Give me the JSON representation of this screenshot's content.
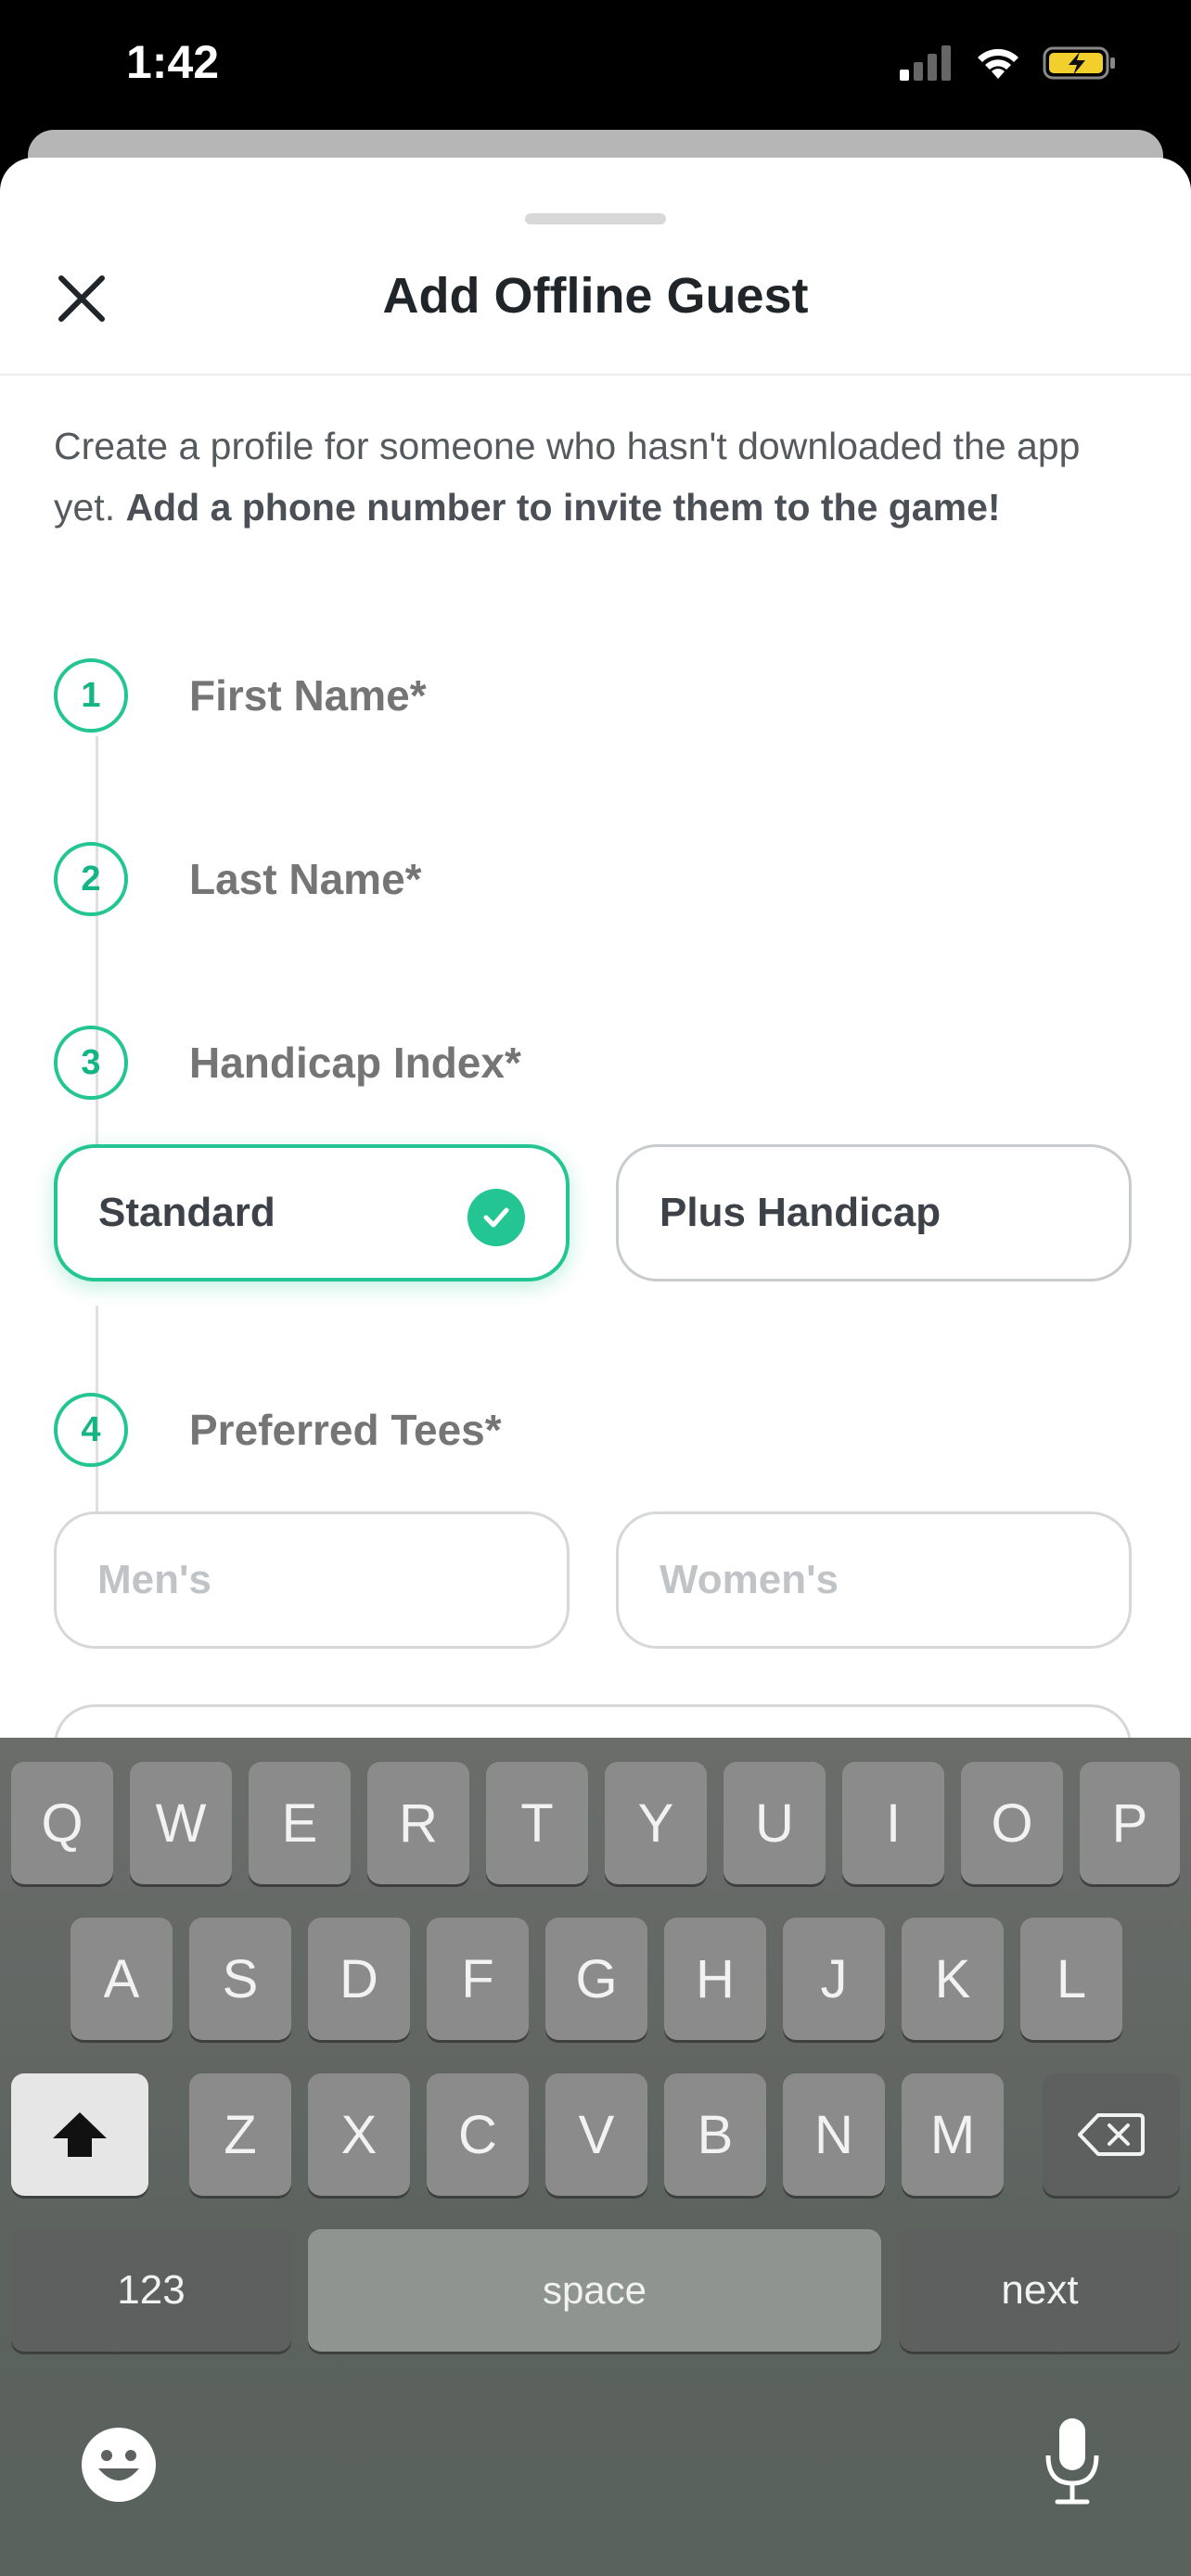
{
  "status_bar": {
    "time": "1:42"
  },
  "sheet": {
    "title": "Add Offline Guest",
    "intro_regular": "Create a profile for someone who hasn't downloaded the app yet. ",
    "intro_bold": "Add a phone number to invite them to the game!",
    "steps": [
      {
        "number": "1",
        "placeholder": "First Name*"
      },
      {
        "number": "2",
        "placeholder": "Last Name*"
      },
      {
        "number": "3",
        "placeholder": "Handicap Index*"
      },
      {
        "number": "4",
        "placeholder": "Preferred Tees*"
      }
    ],
    "handicap_options": [
      {
        "label": "Standard",
        "selected": true
      },
      {
        "label": "Plus Handicap",
        "selected": false
      }
    ],
    "tee_options": [
      {
        "label": "Men's"
      },
      {
        "label": "Women's"
      }
    ]
  },
  "keyboard": {
    "row1": [
      "Q",
      "W",
      "E",
      "R",
      "T",
      "Y",
      "U",
      "I",
      "O",
      "P"
    ],
    "row2": [
      "A",
      "S",
      "D",
      "F",
      "G",
      "H",
      "J",
      "K",
      "L"
    ],
    "row3": [
      "Z",
      "X",
      "C",
      "V",
      "B",
      "N",
      "M"
    ],
    "numbers_key": "123",
    "space_key": "space",
    "next_key": "next",
    "icons": [
      "shift-icon",
      "backspace-icon",
      "emoji-icon",
      "microphone-icon"
    ]
  },
  "colors": {
    "accent": "#23c592",
    "title": "#1f2529",
    "placeholder": "#c4c7ca"
  }
}
